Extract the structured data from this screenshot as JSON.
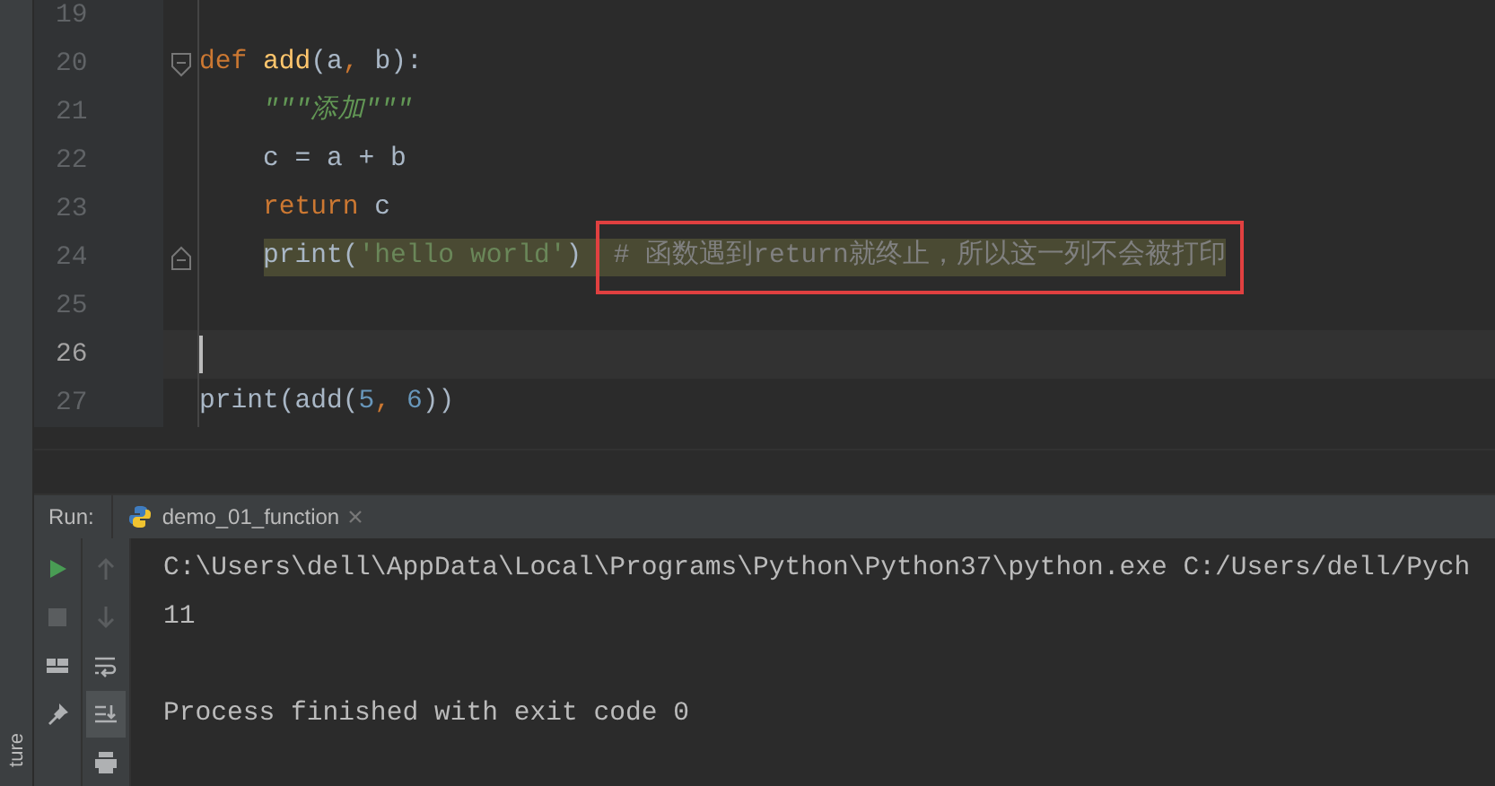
{
  "side_strip": {
    "label": "ture"
  },
  "editor": {
    "lines": [
      {
        "number": "19"
      },
      {
        "number": "20",
        "fold_open": true,
        "tokens": [
          {
            "kind": "keyword",
            "text": "def "
          },
          {
            "kind": "function",
            "text": "add"
          },
          {
            "kind": "plain",
            "text": "(a"
          },
          {
            "kind": "keyword",
            "text": ", "
          },
          {
            "kind": "plain",
            "text": "b):"
          }
        ]
      },
      {
        "number": "21",
        "indented": true,
        "tokens": [
          {
            "kind": "docstring",
            "text": "\"\"\"添加\"\"\""
          }
        ]
      },
      {
        "number": "22",
        "indented": true,
        "tokens": [
          {
            "kind": "plain",
            "text": "c = a + b"
          }
        ]
      },
      {
        "number": "23",
        "indented": true,
        "tokens": [
          {
            "kind": "keyword",
            "text": "return "
          },
          {
            "kind": "plain",
            "text": "c"
          }
        ]
      },
      {
        "number": "24",
        "fold_close": true,
        "indented": true,
        "highlighted": true,
        "tokens": [
          {
            "kind": "plain",
            "text": "print("
          },
          {
            "kind": "string",
            "text": "'hello world'"
          },
          {
            "kind": "plain",
            "text": ")  "
          },
          {
            "kind": "comment",
            "text": "# 函数遇到return就终止，所以这一列不会被打印",
            "boxed": true
          }
        ]
      },
      {
        "number": "25"
      },
      {
        "number": "26",
        "current": true
      },
      {
        "number": "27",
        "tokens": [
          {
            "kind": "plain",
            "text": "print(add("
          },
          {
            "kind": "number",
            "text": "5"
          },
          {
            "kind": "keyword",
            "text": ", "
          },
          {
            "kind": "number",
            "text": "6"
          },
          {
            "kind": "plain",
            "text": "))"
          }
        ]
      }
    ]
  },
  "run_panel": {
    "label": "Run:",
    "tab": {
      "title": "demo_01_function"
    },
    "left_tools": [
      {
        "kind": "run"
      },
      {
        "kind": "stop"
      },
      {
        "kind": "layout"
      },
      {
        "kind": "pin"
      }
    ],
    "right_tools": [
      {
        "kind": "up",
        "selected": false
      },
      {
        "kind": "down",
        "selected": false
      },
      {
        "kind": "wrap",
        "selected": false
      },
      {
        "kind": "scroll-end",
        "selected": true
      },
      {
        "kind": "print",
        "selected": false
      }
    ],
    "console": [
      {
        "kind": "text",
        "text": "C:\\Users\\dell\\AppData\\Local\\Programs\\Python\\Python37\\python.exe C:/Users/dell/Pych"
      },
      {
        "kind": "text",
        "text": "11"
      },
      {
        "kind": "blank"
      },
      {
        "kind": "text",
        "text": "Process finished with exit code 0"
      }
    ]
  }
}
